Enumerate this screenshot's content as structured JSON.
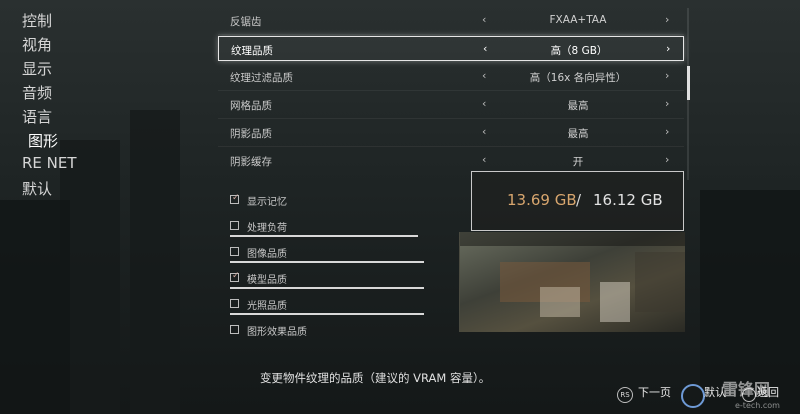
{
  "nav": {
    "items": [
      {
        "label": "控制"
      },
      {
        "label": "视角"
      },
      {
        "label": "显示"
      },
      {
        "label": "音频"
      },
      {
        "label": "语言"
      },
      {
        "label": "图形"
      },
      {
        "label": "RE NET"
      },
      {
        "label": "默认"
      }
    ],
    "active": "图形"
  },
  "settings": {
    "rows": [
      {
        "label": "反锯齿",
        "value": "FXAA+TAA"
      },
      {
        "label": "纹理品质",
        "value": "高（8 GB）",
        "selected": true
      },
      {
        "label": "纹理过滤品质",
        "value": "高（16x 各向异性）"
      },
      {
        "label": "网格品质",
        "value": "最高"
      },
      {
        "label": "阴影品质",
        "value": "最高"
      },
      {
        "label": "阴影缓存",
        "value": "开"
      }
    ],
    "arrow_left": "‹",
    "arrow_right": "›"
  },
  "memory_panel": {
    "checkboxes": [
      {
        "label": "显示记忆",
        "checked": true
      },
      {
        "label": "处理负荷",
        "checked": false
      },
      {
        "label": "图像品质",
        "checked": false
      },
      {
        "label": "模型品质",
        "checked": true
      },
      {
        "label": "光照品质",
        "checked": false
      },
      {
        "label": "图形效果品质",
        "checked": false
      }
    ],
    "vram_used": "13.69 GB",
    "vram_separator": "/",
    "vram_total": "16.12 GB"
  },
  "description": "变更物件纹理的品质（建议的 VRAM 容量）。",
  "footer": {
    "next_page_icon": "RS",
    "next_page_label": "下一页",
    "default_label": "默认",
    "back_label": "返回"
  },
  "watermark": {
    "text": "雷锋网",
    "sub": "e-tech.com"
  },
  "colors": {
    "vram_used": "#d8a66e",
    "selected_border": "#e6e6e6",
    "checkbox_check": "#cfa9a0"
  }
}
